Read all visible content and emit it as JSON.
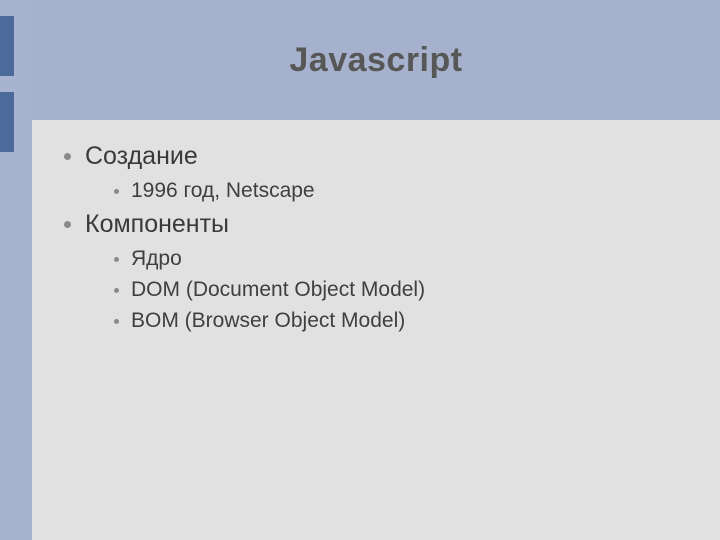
{
  "title": "Javascript",
  "items": [
    {
      "label": "Создание",
      "children": [
        {
          "label": "1996 год, Netscape"
        }
      ]
    },
    {
      "label": "Компоненты",
      "children": [
        {
          "label": "Ядро"
        },
        {
          "label": "DOM (Document Object Model)"
        },
        {
          "label": "BOM (Browser Object Model)"
        }
      ]
    }
  ]
}
